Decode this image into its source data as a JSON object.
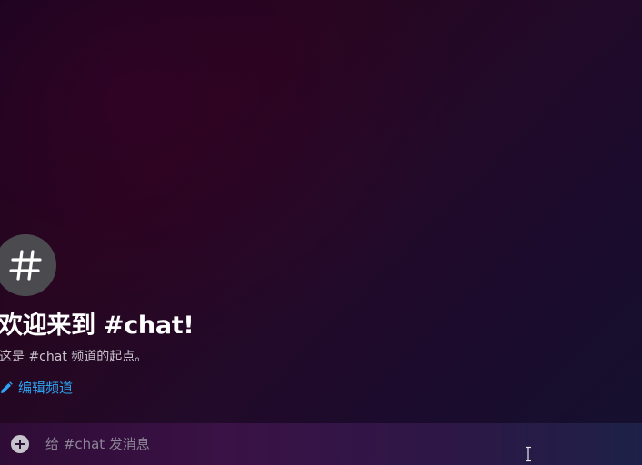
{
  "channel": {
    "avatar_icon": "hash-icon",
    "welcome_title": "欢迎来到 #chat!",
    "welcome_subtitle": "这是 #chat 频道的起点。",
    "edit_label": "编辑频道",
    "edit_icon": "pencil-icon"
  },
  "composer": {
    "attach_icon": "plus-circle-icon",
    "placeholder": "给 #chat 发消息",
    "value": ""
  },
  "colors": {
    "link": "#2ea3f2",
    "avatar_bg": "#4a4a4f",
    "title": "#ffffff"
  }
}
